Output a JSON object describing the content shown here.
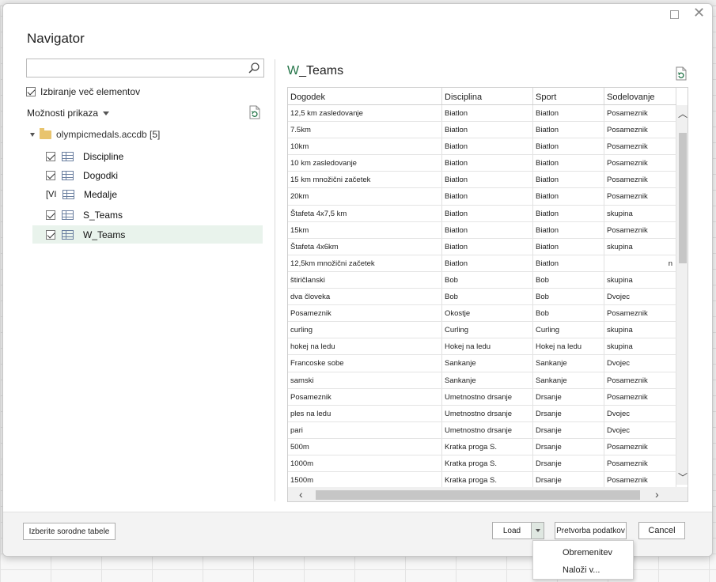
{
  "dialog": {
    "title": "Navigator",
    "search": {
      "value": "",
      "placeholder": ""
    },
    "select_multiple_label": "Izbiranje več elementov",
    "display_options_label": "Možnosti prikaza",
    "tree": {
      "root_label": "olympicmedals.accdb [5]",
      "items": [
        {
          "label": "Discipline",
          "checked": true
        },
        {
          "label": "Dogodki",
          "checked": true
        },
        {
          "label": "Medalje",
          "checked": false,
          "partial_mark": "[VI"
        },
        {
          "label": "S_Teams",
          "checked": true
        },
        {
          "label": "W_Teams",
          "checked": true,
          "selected": true
        }
      ]
    },
    "preview": {
      "title_prefix": "W",
      "title_rest": "_Teams",
      "columns": [
        "Dogodek",
        "Disciplina",
        "Sport",
        "Sodelovanje"
      ],
      "rows": [
        [
          "12,5 km zasledovanje",
          "Biatlon",
          "Biatlon",
          "Posameznik"
        ],
        [
          "7.5km",
          "Biatlon",
          "Biatlon",
          "Posameznik"
        ],
        [
          "10km",
          "Biatlon",
          "Biatlon",
          "Posameznik"
        ],
        [
          "10 km zasledovanje",
          "Biatlon",
          "Biatlon",
          "Posameznik"
        ],
        [
          "15 km množični začetek",
          "Biatlon",
          "Biatlon",
          "Posameznik"
        ],
        [
          "20km",
          "Biatlon",
          "Biatlon",
          "Posameznik"
        ],
        [
          "Štafeta 4x7,5 km",
          "Biatlon",
          "Biatlon",
          "skupina"
        ],
        [
          "15km",
          "Biatlon",
          "Biatlon",
          "Posameznik"
        ],
        [
          "Štafeta 4x6km",
          "Biatlon",
          "Biatlon",
          "skupina"
        ],
        [
          "12,5km množični začetek",
          "Biatlon",
          "Biatlon",
          "n"
        ],
        [
          "štiričlanski",
          "Bob",
          "Bob",
          "skupina"
        ],
        [
          "dva človeka",
          "Bob",
          "Bob",
          "Dvojec"
        ],
        [
          "Posameznik",
          "Okostje",
          "Bob",
          "Posameznik"
        ],
        [
          "curling",
          "Curling",
          "Curling",
          "skupina"
        ],
        [
          "hokej na ledu",
          "Hokej na ledu",
          "Hokej na ledu",
          "skupina"
        ],
        [
          "Francoske sobe",
          "Sankanje",
          "Sankanje",
          "Dvojec"
        ],
        [
          "samski",
          "Sankanje",
          "Sankanje",
          "Posameznik"
        ],
        [
          "Posameznik",
          "Umetnostno drsanje",
          "Drsanje",
          "Posameznik"
        ],
        [
          "ples na ledu",
          "Umetnostno drsanje",
          "Drsanje",
          "Dvojec"
        ],
        [
          "pari",
          "Umetnostno drsanje",
          "Drsanje",
          "Dvojec"
        ],
        [
          "500m",
          "Kratka proga S.",
          "Drsanje",
          "Posameznik"
        ],
        [
          "1000m",
          "Kratka proga S.",
          "Drsanje",
          "Posameznik"
        ],
        [
          "1500m",
          "Kratka proga S.",
          "Drsanje",
          "Posameznik"
        ]
      ]
    },
    "buttons": {
      "related": "Izberite sorodne tabele",
      "load": "Load",
      "transform": "Pretvorba podatkov",
      "cancel": "Cancel"
    },
    "load_menu": [
      "Obremenitev",
      "Naloži v..."
    ]
  },
  "colors": {
    "accent_green": "#217346",
    "selected_row": "#e9f3ec"
  }
}
